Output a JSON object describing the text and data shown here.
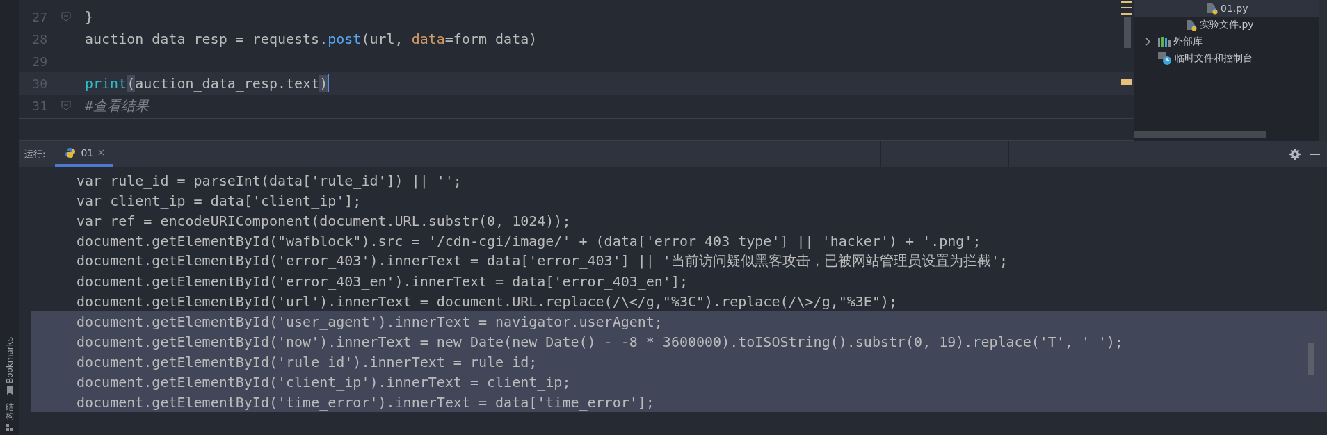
{
  "side_stripe": {
    "items": [
      {
        "label": "Bookmarks",
        "kind": "bookmark"
      },
      {
        "label": "结构",
        "kind": "structure"
      }
    ]
  },
  "editor": {
    "lines": [
      {
        "number": "27",
        "current": false,
        "fold": true,
        "tokens": [
          {
            "kind": "plain",
            "text": "}"
          }
        ]
      },
      {
        "number": "28",
        "current": false,
        "fold": false,
        "tokens": [
          {
            "kind": "plain",
            "text": "auction_data_resp = requests."
          },
          {
            "kind": "function",
            "text": "post"
          },
          {
            "kind": "plain",
            "text": "(url, "
          },
          {
            "kind": "param",
            "text": "data"
          },
          {
            "kind": "plain",
            "text": "=form_data)"
          }
        ]
      },
      {
        "number": "29",
        "current": false,
        "fold": false
      },
      {
        "number": "30",
        "current": true,
        "fold": false,
        "tokens": [
          {
            "kind": "builtin",
            "text": "print"
          },
          {
            "kind": "bracket",
            "text": "("
          },
          {
            "kind": "plain",
            "text": "auction_data_resp.text"
          },
          {
            "kind": "bracket",
            "text": ")"
          }
        ]
      },
      {
        "number": "31",
        "current": false,
        "fold": true,
        "tokens": [
          {
            "kind": "comment",
            "text": "#查看结果"
          }
        ]
      }
    ]
  },
  "project_tree": {
    "items": [
      {
        "label": "01.py",
        "kind": "python-file",
        "selected": true
      },
      {
        "label": "实验文件.py",
        "kind": "python-file",
        "selected": false
      },
      {
        "label": "外部库",
        "kind": "library",
        "selected": false,
        "expanded": false
      },
      {
        "label": "临时文件和控制台",
        "kind": "scratch",
        "selected": false
      }
    ]
  },
  "run_panel": {
    "label": "运行:",
    "tabs": [
      {
        "label": "01",
        "selected": true
      }
    ],
    "console_lines": [
      {
        "text": "var rule_id = parseInt(data['rule_id']) || '';",
        "selected": false
      },
      {
        "text": "var client_ip = data['client_ip'];",
        "selected": false
      },
      {
        "text": "var ref = encodeURIComponent(document.URL.substr(0, 1024));",
        "selected": false
      },
      {
        "text": "document.getElementById(\"wafblock\").src = '/cdn-cgi/image/' + (data['error_403_type'] || 'hacker') + '.png';",
        "selected": false
      },
      {
        "text": "document.getElementById('error_403').innerText = data['error_403'] || '当前访问疑似黑客攻击，已被网站管理员设置为拦截';",
        "selected": false
      },
      {
        "text": "document.getElementById('error_403_en').innerText = data['error_403_en'];",
        "selected": false
      },
      {
        "text": "document.getElementById('url').innerText = document.URL.replace(/\\</g,\"%3C\").replace(/\\>/g,\"%3E\");",
        "selected": false
      },
      {
        "text": "document.getElementById('user_agent').innerText = navigator.userAgent;",
        "selected": true
      },
      {
        "text": "document.getElementById('now').innerText = new Date(new Date() - -8 * 3600000).toISOString().substr(0, 19).replace('T', ' ');",
        "selected": true
      },
      {
        "text": "document.getElementById('rule_id').innerText = rule_id;",
        "selected": true
      },
      {
        "text": "document.getElementById('client_ip').innerText = client_ip;",
        "selected": true
      },
      {
        "text": "document.getElementById('time_error').innerText = data['time_error'];",
        "selected": true
      }
    ]
  }
}
